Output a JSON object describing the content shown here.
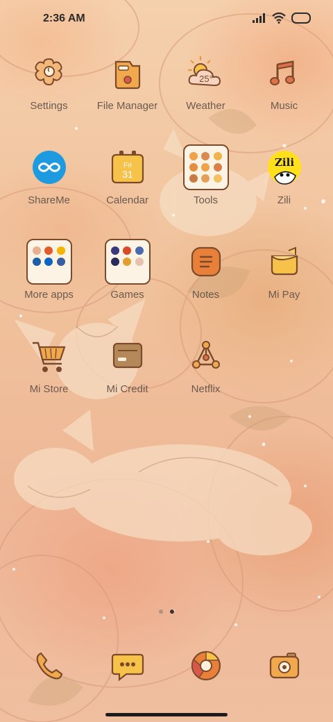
{
  "status_bar": {
    "time": "2:36 AM",
    "icons": [
      "signal-icon",
      "wifi-icon",
      "battery-icon"
    ]
  },
  "apps": [
    {
      "id": "settings",
      "label": "Settings",
      "icon": "gear-icon"
    },
    {
      "id": "file-manager",
      "label": "File Manager",
      "icon": "folder-box-icon"
    },
    {
      "id": "weather",
      "label": "Weather",
      "icon": "weather-icon",
      "temp": "25°"
    },
    {
      "id": "music",
      "label": "Music",
      "icon": "music-note-icon"
    },
    {
      "id": "shareme",
      "label": "ShareMe",
      "icon": "infinity-icon"
    },
    {
      "id": "calendar",
      "label": "Calendar",
      "icon": "calendar-icon",
      "day_name": "Fri",
      "day_num": "31"
    },
    {
      "id": "tools",
      "label": "Tools",
      "icon": "folder-icon"
    },
    {
      "id": "zili",
      "label": "Zili",
      "icon": "zili-icon",
      "logo_text": "Zili"
    },
    {
      "id": "more-apps",
      "label": "More apps",
      "icon": "folder-icon"
    },
    {
      "id": "games",
      "label": "Games",
      "icon": "folder-icon"
    },
    {
      "id": "notes",
      "label": "Notes",
      "icon": "notes-icon"
    },
    {
      "id": "mi-pay",
      "label": "Mi Pay",
      "icon": "wallet-icon"
    },
    {
      "id": "mi-store",
      "label": "Mi Store",
      "icon": "cart-icon"
    },
    {
      "id": "mi-credit",
      "label": "Mi Credit",
      "icon": "card-icon"
    },
    {
      "id": "netflix",
      "label": "Netflix",
      "icon": "share-nodes-icon"
    }
  ],
  "pages": {
    "count": 2,
    "active": 2
  },
  "dock": [
    {
      "id": "phone",
      "icon": "phone-icon"
    },
    {
      "id": "messages",
      "icon": "chat-bubble-icon"
    },
    {
      "id": "browser",
      "icon": "browser-icon"
    },
    {
      "id": "camera",
      "icon": "camera-icon"
    }
  ],
  "colors": {
    "icon_fill": "#f2a94e",
    "icon_stroke": "#7b4a2b",
    "label": "#6b5a4f",
    "shareme_blue": "#1e9be0",
    "zili_yellow": "#ffe01a"
  }
}
